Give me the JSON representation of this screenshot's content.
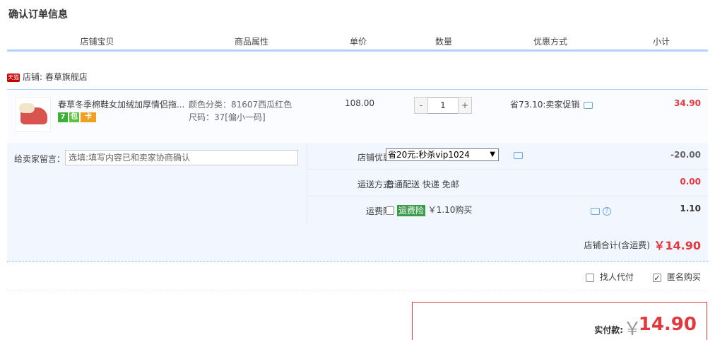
{
  "title": "确认订单信息",
  "table_headers": [
    "店铺宝贝",
    "商品属性",
    "单价",
    "数量",
    "优惠方式",
    "小计"
  ],
  "shop": {
    "badge": "天猫",
    "label": "店铺: 春草旗舰店"
  },
  "item": {
    "name": "春草冬季棉鞋女加绒加厚情侣拖...",
    "badges": [
      "7",
      "包",
      "卡"
    ],
    "attr_color": "颜色分类：81607西瓜红色",
    "attr_size": "尺码：37[偏小一码]",
    "price": "108.00",
    "qty_minus": "-",
    "qty": "1",
    "qty_plus": "+",
    "promo": "省73.10:卖家促销",
    "subtotal": "34.90"
  },
  "options": {
    "memo_label": "给卖家留言：",
    "memo_placeholder": "选填:填写内容已和卖家协商确认",
    "shop_discount_label": "店铺优惠:",
    "shop_discount_selected": "省20元:秒杀vip1024",
    "shop_discount_amount": "-20.00",
    "shipping_label": "运送方式:",
    "shipping_value": "普通配送 快递 免邮",
    "shipping_amount": "0.00",
    "insurance_label": "运费险:",
    "insurance_tag": "运费险",
    "insurance_text": "￥1.10购买",
    "insurance_amount": "1.10"
  },
  "shop_total": {
    "label": "店铺合计(含运费)",
    "amount": "￥14.90"
  },
  "extras": {
    "proxy_pay": "找人代付",
    "anonymous": "匿名购买"
  },
  "payment": {
    "label": "实付款:",
    "currency": "￥",
    "amount": "14.90"
  },
  "colors": {
    "accent_red": "#e4393c",
    "header_line": "#b2d1ff",
    "panel_bg": "#f2f7ff",
    "insurance_green": "#3c9c4c"
  }
}
